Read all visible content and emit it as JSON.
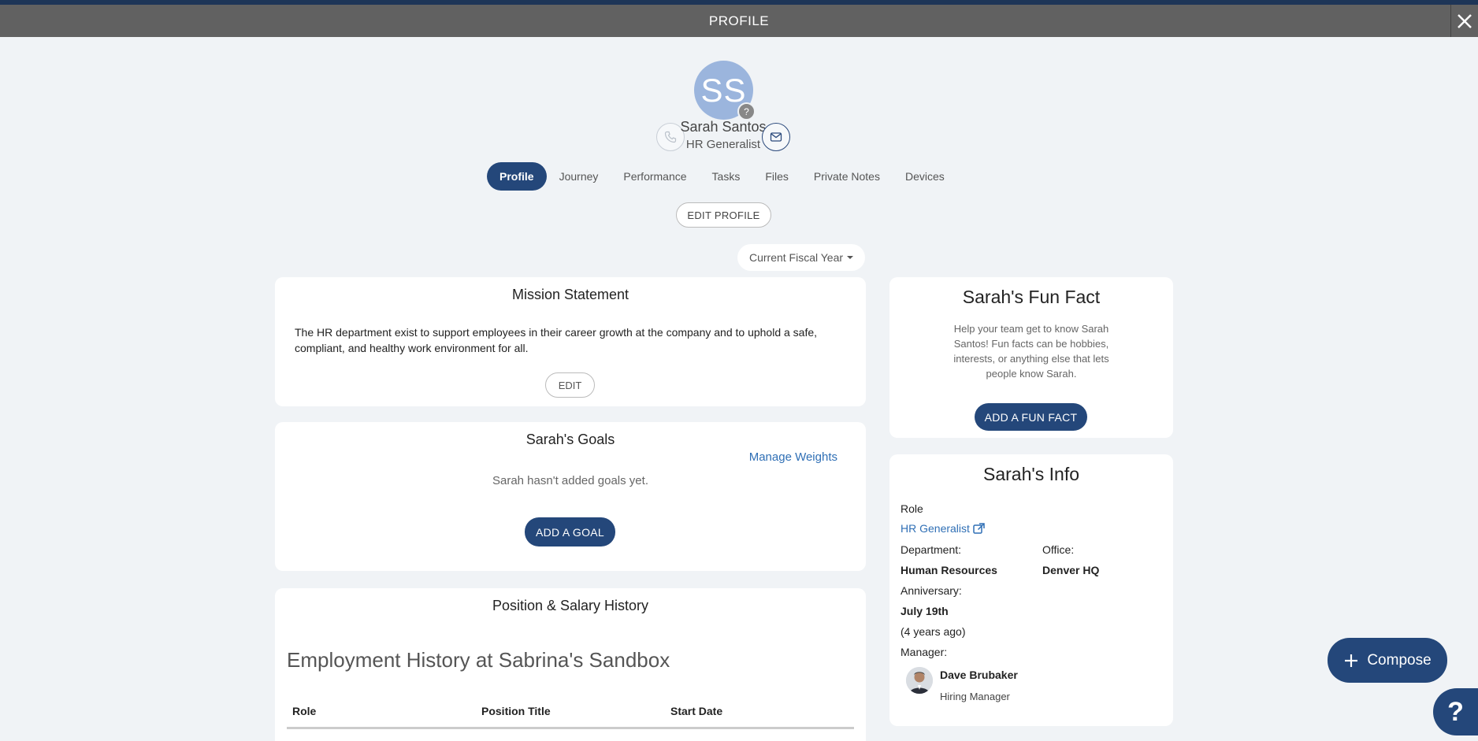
{
  "header": {
    "title": "PROFILE",
    "close_icon": "close-icon"
  },
  "user": {
    "initials": "SS",
    "name": "Sarah Santos",
    "role": "HR Generalist",
    "badge": "?"
  },
  "tabs": [
    {
      "label": "Profile",
      "active": true
    },
    {
      "label": "Journey"
    },
    {
      "label": "Performance"
    },
    {
      "label": "Tasks"
    },
    {
      "label": "Files"
    },
    {
      "label": "Private Notes"
    },
    {
      "label": "Devices"
    }
  ],
  "actions": {
    "edit_profile": "EDIT PROFILE",
    "fiscal_select": "Current Fiscal Year"
  },
  "mission": {
    "title": "Mission Statement",
    "text": "The HR department exist to support employees in their career growth at the company and to uphold a safe, compliant, and healthy work environment for all.",
    "edit_label": "EDIT"
  },
  "goals": {
    "title": "Sarah's Goals",
    "manage_weights": "Manage Weights",
    "empty": "Sarah hasn't added goals yet.",
    "add_label": "ADD A GOAL"
  },
  "salary": {
    "title": "Position & Salary History",
    "employment_title": "Employment History at Sabrina's Sandbox",
    "columns": [
      "Role",
      "Position Title",
      "Start Date"
    ]
  },
  "funfact": {
    "title": "Sarah's Fun Fact",
    "description": "Help your team get to know Sarah Santos! Fun facts can be hobbies, interests, or anything else that lets people know Sarah.",
    "add_label": "ADD A FUN FACT"
  },
  "info": {
    "title": "Sarah's Info",
    "role_label": "Role",
    "role_link": "HR Generalist",
    "department_label": "Department:",
    "department": "Human Resources",
    "office_label": "Office:",
    "office": "Denver HQ",
    "anniversary_label": "Anniversary:",
    "anniversary": "July 19th",
    "anniversary_ago": "(4 years ago)",
    "manager_label": "Manager:",
    "manager_name": "Dave Brubaker",
    "manager_role": "Hiring Manager"
  },
  "compose": {
    "label": "Compose"
  },
  "help": {
    "label": "?"
  },
  "colors": {
    "primary": "#24477a",
    "link": "#2f6fb5",
    "header": "#616161",
    "avatar": "#9bb5dd"
  }
}
